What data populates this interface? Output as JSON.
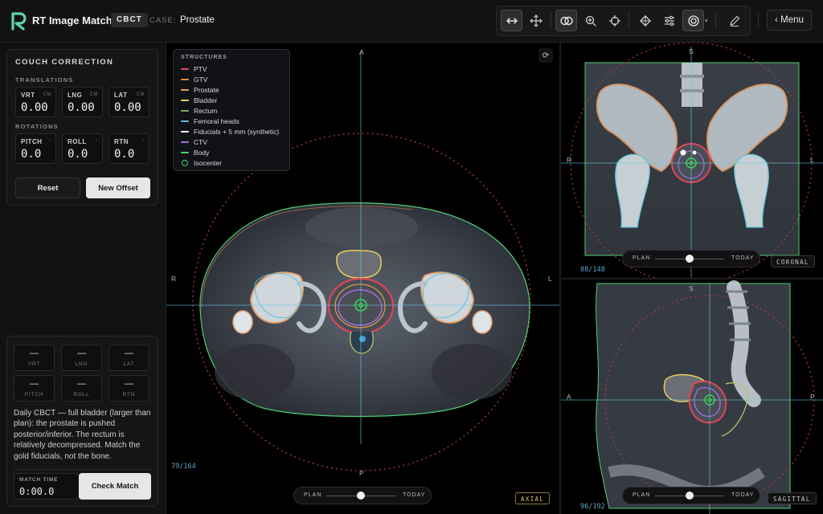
{
  "header": {
    "app_title": "RT Image Match",
    "modality_badge": "CBCT",
    "case_label": "CASE:",
    "case_name": "Prostate",
    "menu_label": "‹ Menu"
  },
  "toolbar": {
    "tools": [
      {
        "icon": "horizontal-arrows-icon",
        "active": true
      },
      {
        "icon": "move-icon",
        "active": false
      },
      {
        "icon": "overlay-rings-icon",
        "active": true
      },
      {
        "icon": "zoom-icon",
        "active": false
      },
      {
        "icon": "crosshair-icon",
        "active": false
      },
      {
        "icon": "diamond-target-icon",
        "active": false
      },
      {
        "icon": "sliders-icon",
        "active": false
      },
      {
        "icon": "contour-target-icon",
        "active": true
      },
      {
        "icon": "pencil-icon",
        "active": false
      }
    ]
  },
  "couch": {
    "title": "COUCH CORRECTION",
    "translations_label": "TRANSLATIONS",
    "rotations_label": "ROTATIONS",
    "translations": [
      {
        "label": "VRT",
        "unit": "CM",
        "value": "0.00"
      },
      {
        "label": "LNG",
        "unit": "CM",
        "value": "0.00"
      },
      {
        "label": "LAT",
        "unit": "CM",
        "value": "0.00"
      }
    ],
    "rotations": [
      {
        "label": "PITCH",
        "unit": "°",
        "value": "0.0"
      },
      {
        "label": "ROLL",
        "unit": "°",
        "value": "0.0"
      },
      {
        "label": "RTN",
        "unit": "°",
        "value": "0.0"
      }
    ],
    "reset_label": "Reset",
    "new_offset_label": "New Offset"
  },
  "match": {
    "results": [
      {
        "label": "VRT",
        "value": "—"
      },
      {
        "label": "LNG",
        "value": "—"
      },
      {
        "label": "LAT",
        "value": "—"
      },
      {
        "label": "PITCH",
        "value": "—"
      },
      {
        "label": "ROLL",
        "value": "—"
      },
      {
        "label": "RTN",
        "value": "—"
      }
    ],
    "description": "Daily CBCT — full bladder (larger than plan): the prostate is pushed posterior/inferior. The rectum is relatively decompressed. Match the gold fiducials, not the bone.",
    "timer_label": "MATCH TIME",
    "timer_value": "0:00.0",
    "check_label": "Check Match"
  },
  "legend": {
    "title": "STRUCTURES",
    "items": [
      {
        "name": "PTV",
        "color": "#e0455a"
      },
      {
        "name": "GTV",
        "color": "#e8893a"
      },
      {
        "name": "Prostate",
        "color": "#f0a548"
      },
      {
        "name": "Bladder",
        "color": "#e7d15a"
      },
      {
        "name": "Rectum",
        "color": "#7fa86a"
      },
      {
        "name": "Femoral heads",
        "color": "#5cc2d6"
      },
      {
        "name": "Fiducials + 5 mm (synthetic)",
        "color": "#f2f2f2"
      },
      {
        "name": "CTV",
        "color": "#a070e0"
      },
      {
        "name": "Body",
        "color": "#4ecf72"
      },
      {
        "name": "Isocenter",
        "color": "#3ed06a"
      }
    ]
  },
  "views": {
    "axial": {
      "tag": "AXIAL",
      "slice": "79/164",
      "top": "A",
      "bottom": "P",
      "left": "R",
      "right": "L",
      "blend": 0.5
    },
    "coronal": {
      "tag": "CORONAL",
      "slice": "88/148",
      "top": "S",
      "left": "R",
      "right": "L",
      "blend": 0.5
    },
    "sagittal": {
      "tag": "SAGITTAL",
      "slice": "96/192",
      "top": "S",
      "left": "A",
      "right": "P",
      "blend": 0.5
    }
  },
  "slider": {
    "plan_label": "PLAN",
    "today_label": "TODAY"
  },
  "colors": {
    "accent": "#3ed06a",
    "axial_tag": "#e7c766",
    "crosshair": "#6fc7e8",
    "ptv": "#e0455a"
  }
}
